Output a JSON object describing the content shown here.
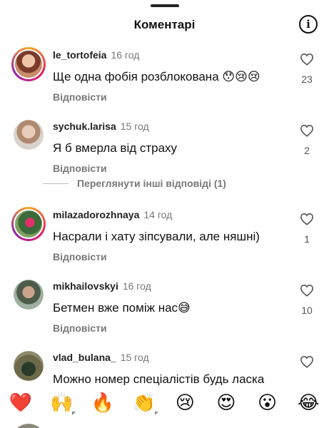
{
  "header": {
    "title": "Коментарі"
  },
  "comments": [
    {
      "username": "le_tortofeia",
      "time": "16 год",
      "text": "Ще одна фобія розблокована 😯😢😢",
      "reply": "Відповісти",
      "likes": "23"
    },
    {
      "username": "sychuk.larisa",
      "time": "15 год",
      "text": "Я б вмерла від страху",
      "reply": "Відповісти",
      "likes": "2"
    },
    {
      "username": "milazadorozhnaya",
      "time": "14 год",
      "text": "Насрали і хату зіпсували, але няшні)",
      "reply": "Відповісти",
      "likes": "1"
    },
    {
      "username": "mikhailovskyi",
      "time": "16 год",
      "text": "Бетмен вже поміж нас😅",
      "reply": "Відповісти",
      "likes": "10"
    },
    {
      "username": "vlad_bulana_",
      "time": "15 год",
      "text": "Можно номер спеціалістів будь ласка",
      "reply": "",
      "likes": ""
    }
  ],
  "more_replies": "Переглянути інші відповіді (1)",
  "emoji_bar": [
    "❤️",
    "🙌",
    "🔥",
    "👏",
    "😢",
    "😍",
    "😮",
    "😂"
  ],
  "icons": {
    "info": "info-circle-icon",
    "like": "heart-outline-icon"
  },
  "colors": {
    "text": "#111111",
    "muted": "#777777",
    "story_ring_start": "#f9a825",
    "story_ring_end": "#8e24aa"
  }
}
